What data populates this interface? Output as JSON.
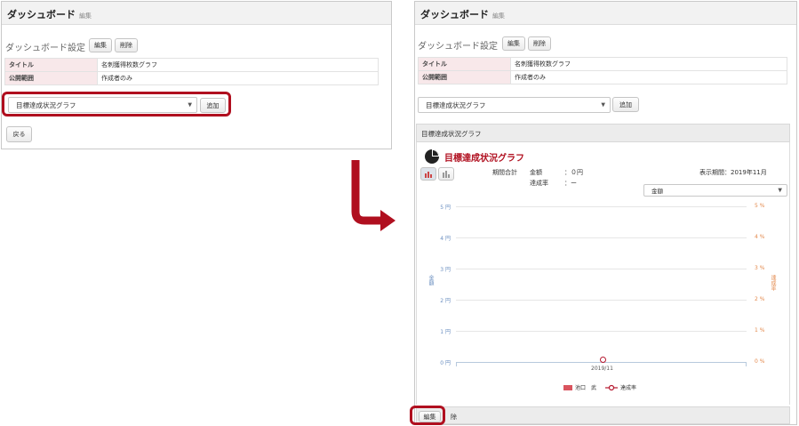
{
  "left": {
    "header_title": "ダッシュボード",
    "header_edit": "編集",
    "section_title": "ダッシュボード設定",
    "edit_btn": "編集",
    "delete_btn": "削除",
    "rows": [
      {
        "label": "タイトル",
        "value": "名刺獲得枚数グラフ"
      },
      {
        "label": "公開範囲",
        "value": "作成者のみ"
      }
    ],
    "select_value": "目標達成状況グラフ",
    "add_btn": "追加",
    "back_btn": "戻る"
  },
  "right": {
    "header_title": "ダッシュボード",
    "header_edit": "編集",
    "section_title": "ダッシュボード設定",
    "edit_btn": "編集",
    "delete_btn": "削除",
    "rows": [
      {
        "label": "タイトル",
        "value": "名刺獲得枚数グラフ"
      },
      {
        "label": "公開範囲",
        "value": "作成者のみ"
      }
    ],
    "select_value": "目標達成状況グラフ",
    "add_btn": "追加",
    "widget_header": "目標達成状況グラフ",
    "widget_title": "目標達成状況グラフ",
    "period_total_label": "期間合計",
    "amount_label": "金額",
    "amount_value": "：０円",
    "rate_label": "達成率",
    "rate_value": "：ー",
    "display_period": "表示期間：2019年11月",
    "metric_select": "金額",
    "footer_edit": "編集",
    "footer_delete": "除"
  },
  "chart_data": {
    "type": "line",
    "x": [
      "2019/11"
    ],
    "y_left_ticks": [
      "5 円",
      "4 円",
      "3 円",
      "2 円",
      "1 円",
      "0 円"
    ],
    "y_right_ticks": [
      "5 %",
      "4 %",
      "3 %",
      "2 %",
      "1 %",
      "0 %"
    ],
    "ylabel_left": "金額",
    "ylabel_right": "達成率",
    "series": [
      {
        "name": "池口　武",
        "type": "bar",
        "values": [
          0
        ],
        "color": "#d9545e"
      },
      {
        "name": "達成率",
        "type": "line",
        "values": [
          0
        ],
        "color": "#b5162d"
      }
    ],
    "ylim": [
      0,
      5
    ],
    "legend": "bottom"
  },
  "colors": {
    "accent": "#b00f1f",
    "arrow": "#b00f1f"
  }
}
